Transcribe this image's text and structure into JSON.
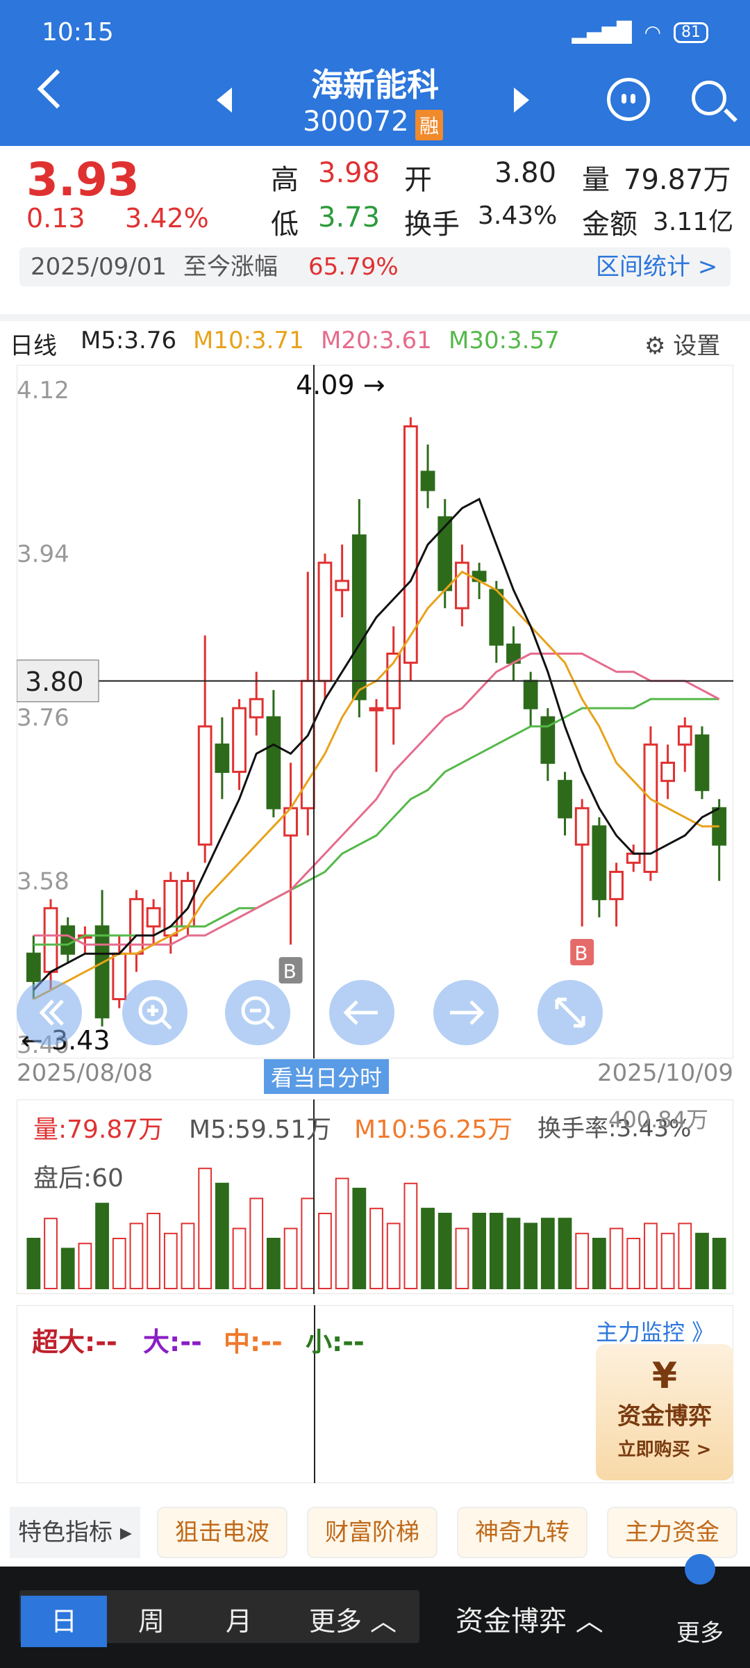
{
  "status": {
    "time": "10:15",
    "battery": "81"
  },
  "header": {
    "name": "海新能科",
    "code": "300072",
    "badge": "融"
  },
  "quote": {
    "price": "3.93",
    "change": "0.13",
    "percent": "3.42%",
    "high_label": "高",
    "high": "3.98",
    "open_label": "开",
    "open": "3.80",
    "vol_label": "量",
    "vol": "79.87万",
    "low_label": "低",
    "low": "3.73",
    "turn_label": "换手",
    "turn": "3.43%",
    "amt_label": "金额",
    "amt": "3.11亿"
  },
  "range": {
    "date": "2025/09/01",
    "label": "至今涨幅",
    "value": "65.79%",
    "link": "区间统计 >"
  },
  "ma_row": {
    "period": "日线",
    "m5": "M5:3.76",
    "m10": "M10:3.71",
    "m20": "M20:3.61",
    "m30": "M30:3.57",
    "settings": "设置"
  },
  "chart_data": {
    "type": "candlestick",
    "y_ticks": [
      "4.12",
      "3.94",
      "3.76",
      "3.58",
      "3.40"
    ],
    "ylim": [
      3.4,
      4.14
    ],
    "crosshair_price": "3.80",
    "max_label": "4.09",
    "min_label": "3.43",
    "x_start": "2025/08/08",
    "x_end": "2025/10/09",
    "candles": [
      {
        "o": 3.5,
        "c": 3.47,
        "h": 3.52,
        "l": 3.45
      },
      {
        "o": 3.48,
        "c": 3.55,
        "h": 3.56,
        "l": 3.46
      },
      {
        "o": 3.53,
        "c": 3.5,
        "h": 3.54,
        "l": 3.49
      },
      {
        "o": 3.52,
        "c": 3.52,
        "h": 3.53,
        "l": 3.5
      },
      {
        "o": 3.53,
        "c": 3.43,
        "h": 3.57,
        "l": 3.42
      },
      {
        "o": 3.45,
        "c": 3.5,
        "h": 3.52,
        "l": 3.44
      },
      {
        "o": 3.5,
        "c": 3.56,
        "h": 3.57,
        "l": 3.48
      },
      {
        "o": 3.53,
        "c": 3.55,
        "h": 3.56,
        "l": 3.51
      },
      {
        "o": 3.52,
        "c": 3.58,
        "h": 3.59,
        "l": 3.5
      },
      {
        "o": 3.53,
        "c": 3.58,
        "h": 3.59,
        "l": 3.52
      },
      {
        "o": 3.62,
        "c": 3.75,
        "h": 3.85,
        "l": 3.6
      },
      {
        "o": 3.73,
        "c": 3.7,
        "h": 3.76,
        "l": 3.67
      },
      {
        "o": 3.7,
        "c": 3.77,
        "h": 3.78,
        "l": 3.68
      },
      {
        "o": 3.76,
        "c": 3.78,
        "h": 3.81,
        "l": 3.74
      },
      {
        "o": 3.76,
        "c": 3.66,
        "h": 3.79,
        "l": 3.65
      },
      {
        "o": 3.63,
        "c": 3.66,
        "h": 3.71,
        "l": 3.51
      },
      {
        "o": 3.66,
        "c": 3.8,
        "h": 3.92,
        "l": 3.63
      },
      {
        "o": 3.8,
        "c": 3.93,
        "h": 3.94,
        "l": 3.78
      },
      {
        "o": 3.9,
        "c": 3.91,
        "h": 3.95,
        "l": 3.87
      },
      {
        "o": 3.96,
        "c": 3.78,
        "h": 4.0,
        "l": 3.76
      },
      {
        "o": 3.77,
        "c": 3.77,
        "h": 3.78,
        "l": 3.7
      },
      {
        "o": 3.77,
        "c": 3.83,
        "h": 3.86,
        "l": 3.73
      },
      {
        "o": 3.82,
        "c": 4.08,
        "h": 4.09,
        "l": 3.8
      },
      {
        "o": 4.03,
        "c": 4.01,
        "h": 4.06,
        "l": 3.99
      },
      {
        "o": 3.98,
        "c": 3.9,
        "h": 4.0,
        "l": 3.88
      },
      {
        "o": 3.88,
        "c": 3.93,
        "h": 3.95,
        "l": 3.86
      },
      {
        "o": 3.92,
        "c": 3.91,
        "h": 3.93,
        "l": 3.89
      },
      {
        "o": 3.9,
        "c": 3.84,
        "h": 3.91,
        "l": 3.82
      },
      {
        "o": 3.84,
        "c": 3.82,
        "h": 3.86,
        "l": 3.8
      },
      {
        "o": 3.8,
        "c": 3.77,
        "h": 3.81,
        "l": 3.75
      },
      {
        "o": 3.76,
        "c": 3.71,
        "h": 3.77,
        "l": 3.69
      },
      {
        "o": 3.69,
        "c": 3.65,
        "h": 3.7,
        "l": 3.63
      },
      {
        "o": 3.62,
        "c": 3.66,
        "h": 3.67,
        "l": 3.53
      },
      {
        "o": 3.64,
        "c": 3.56,
        "h": 3.65,
        "l": 3.54
      },
      {
        "o": 3.56,
        "c": 3.59,
        "h": 3.6,
        "l": 3.53
      },
      {
        "o": 3.6,
        "c": 3.61,
        "h": 3.62,
        "l": 3.59
      },
      {
        "o": 3.59,
        "c": 3.73,
        "h": 3.75,
        "l": 3.58
      },
      {
        "o": 3.69,
        "c": 3.71,
        "h": 3.73,
        "l": 3.67
      },
      {
        "o": 3.73,
        "c": 3.75,
        "h": 3.76,
        "l": 3.7
      },
      {
        "o": 3.74,
        "c": 3.68,
        "h": 3.75,
        "l": 3.67
      },
      {
        "o": 3.66,
        "c": 3.62,
        "h": 3.67,
        "l": 3.58
      }
    ],
    "ma5": [
      3.46,
      3.48,
      3.49,
      3.5,
      3.5,
      3.5,
      3.52,
      3.52,
      3.53,
      3.55,
      3.59,
      3.63,
      3.67,
      3.72,
      3.73,
      3.72,
      3.74,
      3.78,
      3.81,
      3.84,
      3.87,
      3.89,
      3.91,
      3.95,
      3.97,
      3.99,
      4.0,
      3.95,
      3.9,
      3.86,
      3.81,
      3.75,
      3.7,
      3.66,
      3.63,
      3.61,
      3.61,
      3.62,
      3.63,
      3.65,
      3.66
    ],
    "ma10": [
      3.45,
      3.46,
      3.47,
      3.48,
      3.49,
      3.5,
      3.5,
      3.51,
      3.52,
      3.53,
      3.56,
      3.58,
      3.6,
      3.62,
      3.64,
      3.66,
      3.69,
      3.72,
      3.76,
      3.79,
      3.8,
      3.82,
      3.85,
      3.88,
      3.9,
      3.92,
      3.91,
      3.9,
      3.88,
      3.86,
      3.84,
      3.82,
      3.78,
      3.75,
      3.71,
      3.69,
      3.67,
      3.66,
      3.65,
      3.64,
      3.64
    ],
    "ma20": [
      3.52,
      3.52,
      3.52,
      3.51,
      3.51,
      3.51,
      3.51,
      3.51,
      3.51,
      3.52,
      3.52,
      3.53,
      3.54,
      3.55,
      3.56,
      3.57,
      3.59,
      3.61,
      3.63,
      3.65,
      3.67,
      3.7,
      3.72,
      3.74,
      3.76,
      3.77,
      3.79,
      3.81,
      3.82,
      3.83,
      3.83,
      3.83,
      3.83,
      3.82,
      3.81,
      3.81,
      3.8,
      3.8,
      3.8,
      3.79,
      3.78
    ],
    "ma30": [
      3.51,
      3.51,
      3.51,
      3.52,
      3.52,
      3.52,
      3.52,
      3.52,
      3.53,
      3.53,
      3.53,
      3.54,
      3.55,
      3.55,
      3.56,
      3.57,
      3.58,
      3.59,
      3.61,
      3.62,
      3.63,
      3.65,
      3.67,
      3.68,
      3.7,
      3.71,
      3.72,
      3.73,
      3.74,
      3.75,
      3.75,
      3.76,
      3.77,
      3.77,
      3.77,
      3.77,
      3.78,
      3.78,
      3.78,
      3.78,
      3.78
    ],
    "buy_marks": [
      "B",
      "B"
    ],
    "volume": [
      20,
      28,
      16,
      18,
      34,
      20,
      26,
      30,
      22,
      26,
      48,
      42,
      24,
      36,
      20,
      24,
      36,
      30,
      44,
      40,
      32,
      26,
      42,
      32,
      30,
      24,
      30,
      30,
      28,
      26,
      28,
      28,
      22,
      20,
      24,
      20,
      26,
      22,
      26,
      22,
      20
    ]
  },
  "controls": [
    "back-icon",
    "zoom-in-icon",
    "zoom-out-icon",
    "left-arrow-icon",
    "right-arrow-icon",
    "fullscreen-icon"
  ],
  "fenshi": "看当日分时",
  "vol_panel": {
    "vol": "量:79.87万",
    "m5": "M5:59.51万",
    "m10": "M10:56.25万",
    "turn": "换手率:3.43%",
    "max": "400.84万",
    "after": "盘后:60"
  },
  "flow": {
    "super": "超大:--",
    "big": "大:--",
    "mid": "中:--",
    "small": "小:--",
    "monitor": "主力监控 》"
  },
  "promo": {
    "title": "资金博弈",
    "sub": "立即购买 >"
  },
  "chips": {
    "label": "特色指标 ▸",
    "items": [
      "狙击电波",
      "财富阶梯",
      "神奇九转",
      "主力资金"
    ]
  },
  "bottom": {
    "tabs": [
      "日",
      "周",
      "月",
      "更多 ︿"
    ],
    "game": "资金博弈 ︿",
    "more": "更多"
  }
}
